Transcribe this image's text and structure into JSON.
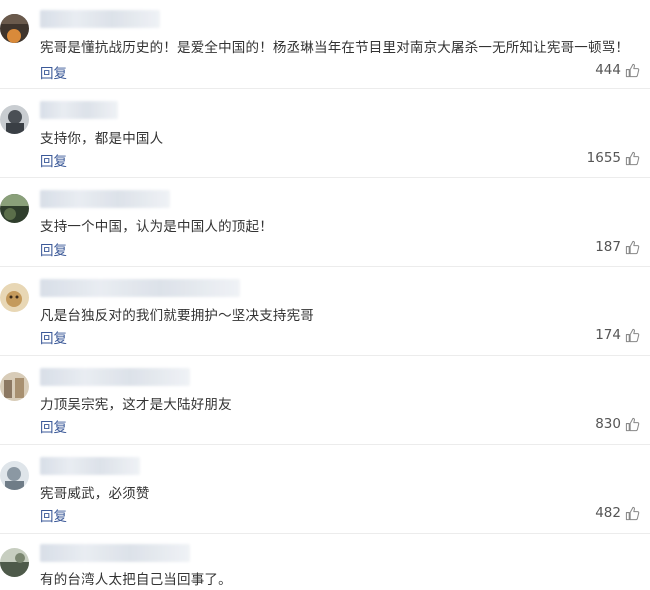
{
  "comments": [
    {
      "text": "宪哥是懂抗战历史的！是爱全中国的！杨丞琳当年在节目里对南京大屠杀一无所知让宪哥一顿骂！",
      "reply_label": "回复",
      "likes": "444",
      "avatar_color": "#5a4a3c"
    },
    {
      "text": "支持你，都是中国人",
      "reply_label": "回复",
      "likes": "1655",
      "avatar_color": "#6b6f73"
    },
    {
      "text": "支持一个中国，认为是中国人的顶起！",
      "reply_label": "回复",
      "likes": "187",
      "avatar_color": "#3f5a3a"
    },
    {
      "text": "凡是台独反对的我们就要拥护～坚决支持宪哥",
      "reply_label": "回复",
      "likes": "174",
      "avatar_color": "#c9b48e"
    },
    {
      "text": "力顶吴宗宪，这才是大陆好朋友",
      "reply_label": "回复",
      "likes": "830",
      "avatar_color": "#b9a58a"
    },
    {
      "text": "宪哥威武，必须赞",
      "reply_label": "回复",
      "likes": "482",
      "avatar_color": "#9aa7b0"
    },
    {
      "text": "有的台湾人太把自己当回事了。",
      "avatar_color": "#4e5a4a"
    }
  ]
}
